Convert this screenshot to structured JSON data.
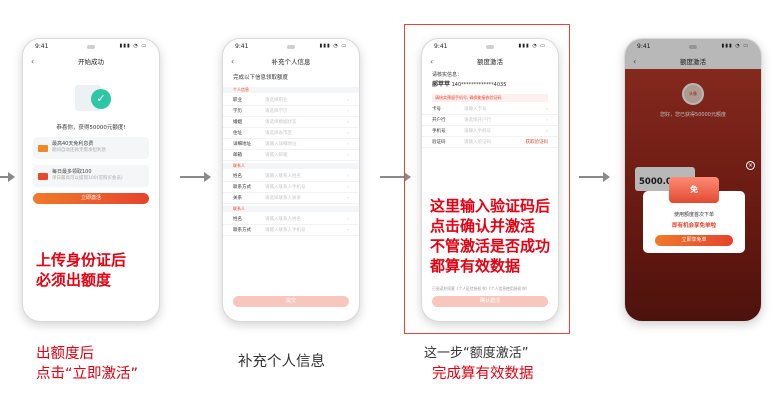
{
  "phones": {
    "p1": {
      "time": "9:41",
      "title": "开始成功",
      "congrats": "恭喜你，获得50000元额度!",
      "perk1_title": "最高40天免利息费",
      "perk1_sub": "期间自动还款无需承担利息",
      "perk2_title": "每日最多领取100",
      "perk2_sub": "单日最高可以提现100(可购买会员)",
      "cta": "立即激活"
    },
    "p2": {
      "time": "9:41",
      "title": "补充个人信息",
      "head": "完成以下信息领取额度",
      "sec1": "个人信息",
      "sec2": "联系人",
      "sec3": "联系人",
      "rows": [
        {
          "label": "职业",
          "ph": "请选择职业"
        },
        {
          "label": "学历",
          "ph": "请选择学历"
        },
        {
          "label": "婚姻",
          "ph": "请选择婚姻状态"
        },
        {
          "label": "住址",
          "ph": "请选择省市区"
        },
        {
          "label": "详细地址",
          "ph": "请输入详细地址"
        },
        {
          "label": "邮箱",
          "ph": "请输入邮箱"
        }
      ],
      "rows2": [
        {
          "label": "姓名",
          "ph": "请输入联系人姓名"
        },
        {
          "label": "联系方式",
          "ph": "请输入联系人手机号"
        },
        {
          "label": "关系",
          "ph": "请选择联系人关系"
        }
      ],
      "rows3": [
        {
          "label": "姓名",
          "ph": "请输入联系人姓名"
        },
        {
          "label": "联系方式",
          "ph": "请输入联系人手机号"
        }
      ],
      "submit": "提交"
    },
    "p3": {
      "time": "9:41",
      "title": "额度激活",
      "greet": "请核实信息：",
      "name": "郝苹苹",
      "idnum": "140*************4035",
      "hint": "请核实预留手机号, 确保能接收验证码",
      "rows": [
        {
          "label": "卡号",
          "ph": "请输入卡号"
        },
        {
          "label": "开户行",
          "ph": "请选择开户行"
        },
        {
          "label": "手机号",
          "ph": "请输入手机号"
        },
        {
          "label": "验证码",
          "ph": "请输入验证码",
          "link": "获取验证码"
        }
      ],
      "agree": "已阅读并同意《个人征信授权书》《个人信息使用授权书》",
      "submit": "确认激活"
    },
    "p4": {
      "time": "9:41",
      "title": "额度激活",
      "avatar": "头像",
      "hello": "您好，您已获得50000元额度",
      "amount": "5000.00",
      "gift": "免",
      "m1": "使用额度首次下单",
      "m2": "即有机会享免单啦",
      "btn": "立即享免单"
    }
  },
  "overlays": {
    "p1_note_line1": "上传身份证后",
    "p1_note_line2": "必须出额度",
    "p3_note_line1": "这里输入验证码后",
    "p3_note_line2": "点击确认并激活",
    "p3_note_line3": "不管激活是否成功",
    "p3_note_line4": "都算有效数据"
  },
  "captions": {
    "c1_line1": "出额度后",
    "c1_line2": "点击“立即激活”",
    "c2": "补充个人信息",
    "c3_line1": "这一步“额度激活”",
    "c3_line2": "完成算有效数据"
  }
}
